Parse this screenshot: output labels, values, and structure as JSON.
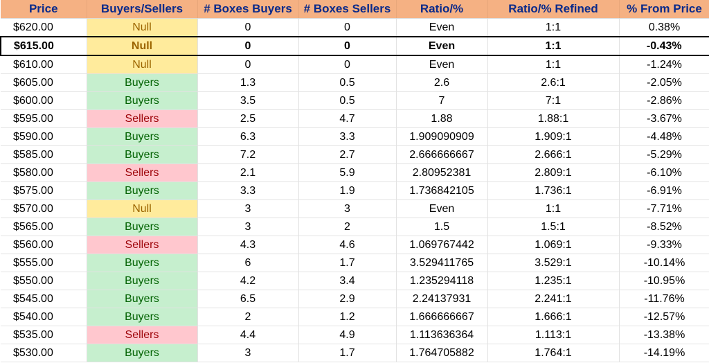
{
  "headers": {
    "price": "Price",
    "buyers_sellers": "Buyers/Sellers",
    "boxes_buyers": "# Boxes Buyers",
    "boxes_sellers": "# Boxes Sellers",
    "ratio": "Ratio/%",
    "ratio_refined": "Ratio/% Refined",
    "pct_from_price": "% From Price"
  },
  "colors": {
    "header_bg": "#f5b183",
    "header_text": "#0a2a8a",
    "buyers_bg": "#c6efce",
    "buyers_text": "#006100",
    "sellers_bg": "#ffc7ce",
    "sellers_text": "#9c0006",
    "null_bg": "#ffeb9c",
    "null_text": "#9c6500"
  },
  "rows": [
    {
      "price": "$620.00",
      "side": "Null",
      "boxes_buyers": "0",
      "boxes_sellers": "0",
      "ratio": "Even",
      "ratio_refined": "1:1",
      "pct": "0.38%",
      "current": false
    },
    {
      "price": "$615.00",
      "side": "Null",
      "boxes_buyers": "0",
      "boxes_sellers": "0",
      "ratio": "Even",
      "ratio_refined": "1:1",
      "pct": "-0.43%",
      "current": true
    },
    {
      "price": "$610.00",
      "side": "Null",
      "boxes_buyers": "0",
      "boxes_sellers": "0",
      "ratio": "Even",
      "ratio_refined": "1:1",
      "pct": "-1.24%",
      "current": false
    },
    {
      "price": "$605.00",
      "side": "Buyers",
      "boxes_buyers": "1.3",
      "boxes_sellers": "0.5",
      "ratio": "2.6",
      "ratio_refined": "2.6:1",
      "pct": "-2.05%",
      "current": false
    },
    {
      "price": "$600.00",
      "side": "Buyers",
      "boxes_buyers": "3.5",
      "boxes_sellers": "0.5",
      "ratio": "7",
      "ratio_refined": "7:1",
      "pct": "-2.86%",
      "current": false
    },
    {
      "price": "$595.00",
      "side": "Sellers",
      "boxes_buyers": "2.5",
      "boxes_sellers": "4.7",
      "ratio": "1.88",
      "ratio_refined": "1.88:1",
      "pct": "-3.67%",
      "current": false
    },
    {
      "price": "$590.00",
      "side": "Buyers",
      "boxes_buyers": "6.3",
      "boxes_sellers": "3.3",
      "ratio": "1.909090909",
      "ratio_refined": "1.909:1",
      "pct": "-4.48%",
      "current": false
    },
    {
      "price": "$585.00",
      "side": "Buyers",
      "boxes_buyers": "7.2",
      "boxes_sellers": "2.7",
      "ratio": "2.666666667",
      "ratio_refined": "2.666:1",
      "pct": "-5.29%",
      "current": false
    },
    {
      "price": "$580.00",
      "side": "Sellers",
      "boxes_buyers": "2.1",
      "boxes_sellers": "5.9",
      "ratio": "2.80952381",
      "ratio_refined": "2.809:1",
      "pct": "-6.10%",
      "current": false
    },
    {
      "price": "$575.00",
      "side": "Buyers",
      "boxes_buyers": "3.3",
      "boxes_sellers": "1.9",
      "ratio": "1.736842105",
      "ratio_refined": "1.736:1",
      "pct": "-6.91%",
      "current": false
    },
    {
      "price": "$570.00",
      "side": "Null",
      "boxes_buyers": "3",
      "boxes_sellers": "3",
      "ratio": "Even",
      "ratio_refined": "1:1",
      "pct": "-7.71%",
      "current": false
    },
    {
      "price": "$565.00",
      "side": "Buyers",
      "boxes_buyers": "3",
      "boxes_sellers": "2",
      "ratio": "1.5",
      "ratio_refined": "1.5:1",
      "pct": "-8.52%",
      "current": false
    },
    {
      "price": "$560.00",
      "side": "Sellers",
      "boxes_buyers": "4.3",
      "boxes_sellers": "4.6",
      "ratio": "1.069767442",
      "ratio_refined": "1.069:1",
      "pct": "-9.33%",
      "current": false
    },
    {
      "price": "$555.00",
      "side": "Buyers",
      "boxes_buyers": "6",
      "boxes_sellers": "1.7",
      "ratio": "3.529411765",
      "ratio_refined": "3.529:1",
      "pct": "-10.14%",
      "current": false
    },
    {
      "price": "$550.00",
      "side": "Buyers",
      "boxes_buyers": "4.2",
      "boxes_sellers": "3.4",
      "ratio": "1.235294118",
      "ratio_refined": "1.235:1",
      "pct": "-10.95%",
      "current": false
    },
    {
      "price": "$545.00",
      "side": "Buyers",
      "boxes_buyers": "6.5",
      "boxes_sellers": "2.9",
      "ratio": "2.24137931",
      "ratio_refined": "2.241:1",
      "pct": "-11.76%",
      "current": false
    },
    {
      "price": "$540.00",
      "side": "Buyers",
      "boxes_buyers": "2",
      "boxes_sellers": "1.2",
      "ratio": "1.666666667",
      "ratio_refined": "1.666:1",
      "pct": "-12.57%",
      "current": false
    },
    {
      "price": "$535.00",
      "side": "Sellers",
      "boxes_buyers": "4.4",
      "boxes_sellers": "4.9",
      "ratio": "1.113636364",
      "ratio_refined": "1.113:1",
      "pct": "-13.38%",
      "current": false
    },
    {
      "price": "$530.00",
      "side": "Buyers",
      "boxes_buyers": "3",
      "boxes_sellers": "1.7",
      "ratio": "1.764705882",
      "ratio_refined": "1.764:1",
      "pct": "-14.19%",
      "current": false
    }
  ]
}
